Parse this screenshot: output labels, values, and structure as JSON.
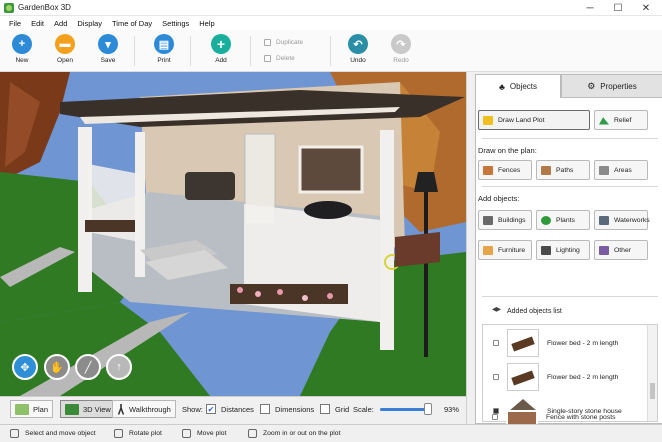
{
  "window": {
    "title": "GardenBox 3D",
    "minimize": "─",
    "maximize": "☐",
    "close": "✕"
  },
  "menu": [
    "File",
    "Edit",
    "Add",
    "Display",
    "Time of Day",
    "Settings",
    "Help"
  ],
  "toolbar": {
    "new": "New",
    "open": "Open",
    "save": "Save",
    "print": "Print",
    "add": "Add",
    "duplicate": "Duplicate",
    "delete": "Delete",
    "undo": "Undo",
    "redo": "Redo"
  },
  "panel": {
    "tabs": {
      "objects": "Objects",
      "properties": "Properties"
    },
    "draw_land_plot": "Draw Land Plot",
    "relief": "Relief",
    "draw_on_plan": "Draw on the plan:",
    "fences": "Fences",
    "paths": "Paths",
    "areas": "Areas",
    "add_objects": "Add objects:",
    "buildings": "Buildings",
    "plants": "Plants",
    "waterworks": "Waterworks",
    "furniture": "Furniture",
    "lighting": "Lighting",
    "other": "Other",
    "added_list_title": "Added objects list",
    "items": [
      {
        "name": "Flower bed - 2 m length"
      },
      {
        "name": "Flower bed - 2 m length"
      },
      {
        "name": "Single-story stone house"
      },
      {
        "name": "Fence with stone posts"
      }
    ]
  },
  "viewbar": {
    "plan": "Plan",
    "view3d": "3D View",
    "walkthrough": "Walkthrough",
    "show": "Show:",
    "distances": "Distances",
    "distances_checked": true,
    "dimensions": "Dimensions",
    "dimensions_checked": false,
    "grid": "Grid",
    "grid_checked": false,
    "scale": "Scale:",
    "scale_value": "93%",
    "scale_fraction": 0.93
  },
  "status": {
    "select": "Select and move object",
    "rotate": "Rotate plot",
    "move": "Move plot",
    "zoom": "Zoom in or out on the plot"
  },
  "colors": {
    "accent_blue": "#2d8ad6",
    "open_orange": "#f3a11c",
    "add_teal": "#1aae9c",
    "undo_teal": "#2a8fa6",
    "slider_blue": "#3a7fd6",
    "sky": "#6f95d2",
    "lawn": "#2f7a22",
    "house_wall": "#d8c8b4",
    "roof": "#3a302a"
  }
}
